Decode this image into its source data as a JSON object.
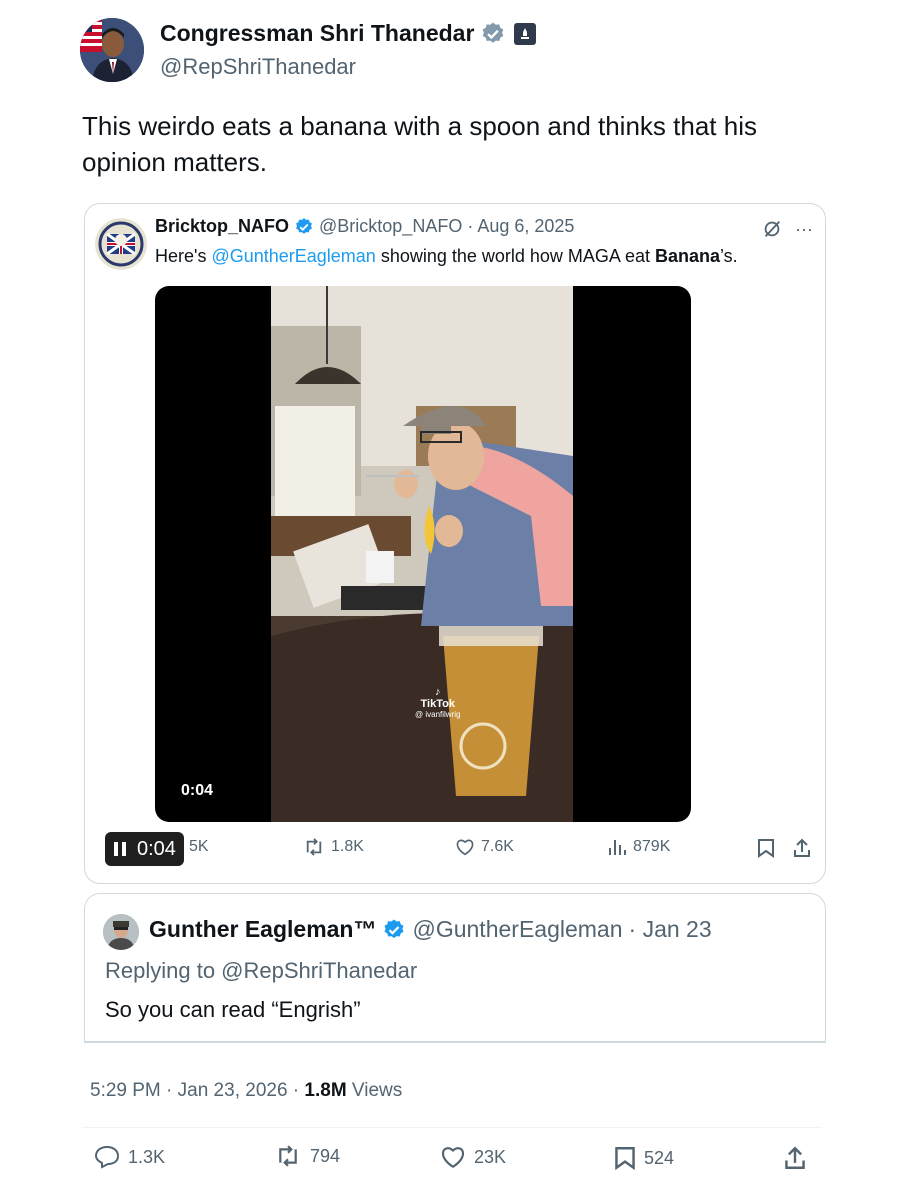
{
  "author": {
    "name": "Congressman Shri Thanedar",
    "handle": "@RepShriThanedar"
  },
  "tweet": {
    "text": "This weirdo eats a banana with a spoon and thinks that his opinion matters."
  },
  "quoted": {
    "name": "Bricktop_NAFO",
    "handle": "@Bricktop_NAFO",
    "date": "· Aug 6, 2025",
    "text_prefix": "Here's ",
    "mention": "@GuntherEagleman",
    "text_middle": " showing the world how MAGA eat ",
    "text_bold": "Banana",
    "text_suffix": "’s.",
    "video_time": "0:04",
    "tiktok_label": "TikTok",
    "tiktok_user": "@ ivanfilwrig",
    "actions": {
      "player_time": "0:04",
      "replies": "5K",
      "reposts": "1.8K",
      "likes": "7.6K",
      "views": "879K"
    }
  },
  "reply": {
    "name": "Gunther Eagleman™",
    "handle": "@GuntherEagleman",
    "date": "· Jan 23",
    "replying_to": "Replying to @RepShriThanedar",
    "text": "So you can read “Engrish”"
  },
  "meta": {
    "time_date": "5:29 PM · Jan 23, 2026 · ",
    "views_count": "1.8M",
    "views_label": " Views"
  },
  "bottom_actions": {
    "replies": "1.3K",
    "reposts": "794",
    "likes": "23K",
    "bookmarks": "524"
  },
  "colors": {
    "accent": "#1d9bf0",
    "muted": "#536471",
    "text": "#0f1419",
    "border": "#cfd9de"
  }
}
